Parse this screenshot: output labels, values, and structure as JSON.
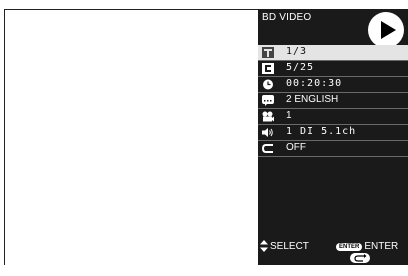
{
  "osd": {
    "disc_type": "BD VIDEO",
    "play_icon": "play-icon",
    "rows": [
      {
        "icon": "title-icon",
        "value": "1/3"
      },
      {
        "icon": "chapter-icon",
        "value": "5/25"
      },
      {
        "icon": "time-icon",
        "value": "00:20:30"
      },
      {
        "icon": "subtitle-icon",
        "value": "2 ENGLISH"
      },
      {
        "icon": "angle-icon",
        "value": "1"
      },
      {
        "icon": "audio-icon",
        "value": "1 DI 5.1ch"
      },
      {
        "icon": "repeat-icon",
        "value": "OFF"
      }
    ],
    "footer": {
      "select_label": "SELECT",
      "enter_pill": "ENTER",
      "enter_label": "ENTER",
      "return_label": "RETURN"
    }
  },
  "colors": {
    "panel_bg": "#1a1a1a",
    "highlight_row": "#e4e4e4",
    "text": "#ffffff"
  }
}
